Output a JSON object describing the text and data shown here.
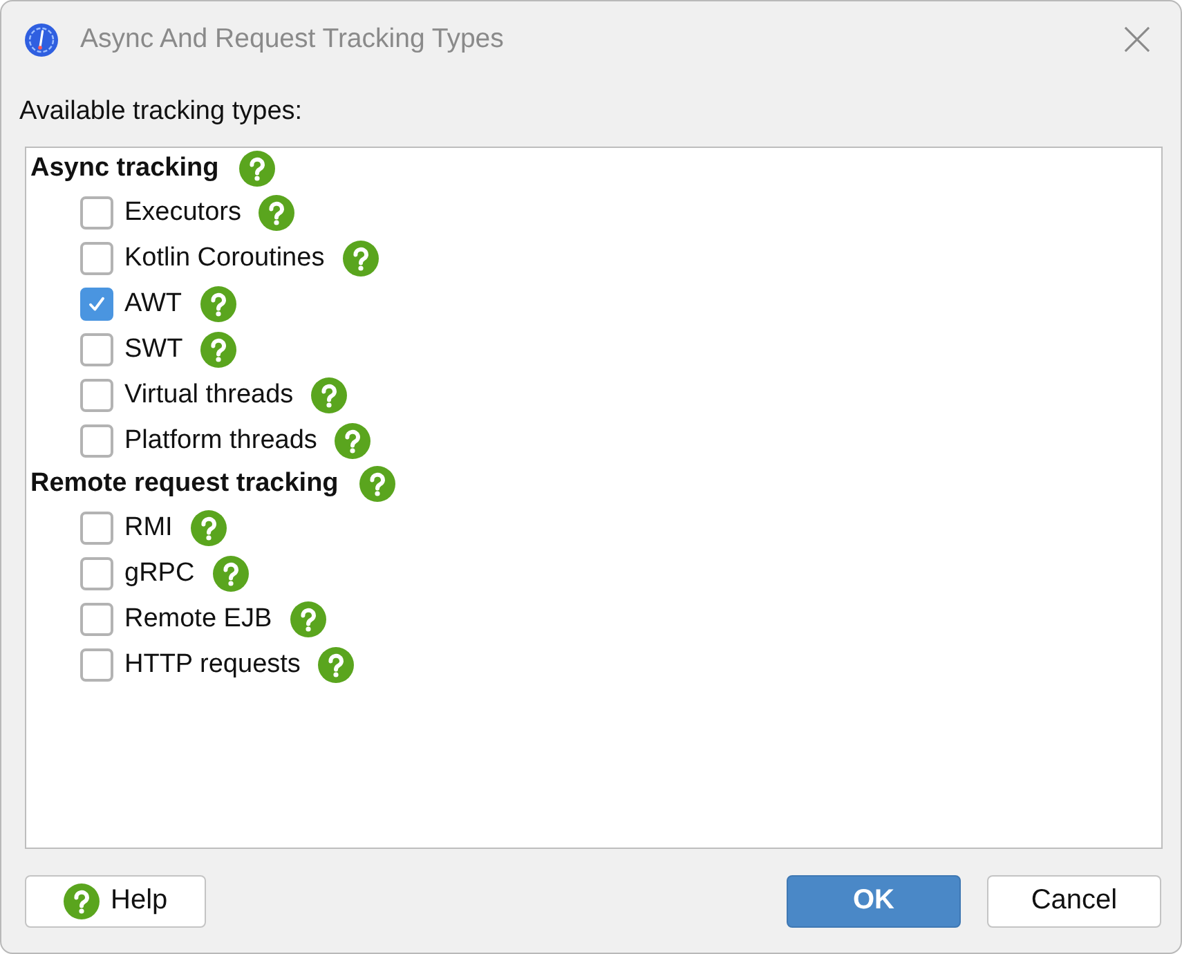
{
  "window": {
    "title": "Async And Request Tracking Types"
  },
  "list_label": "Available tracking types:",
  "tracking_types": [
    {
      "label": "Async tracking",
      "children": [
        {
          "label": "Executors",
          "checked": false
        },
        {
          "label": "Kotlin Coroutines",
          "checked": false
        },
        {
          "label": "AWT",
          "checked": true
        },
        {
          "label": "SWT",
          "checked": false
        },
        {
          "label": "Virtual threads",
          "checked": false
        },
        {
          "label": "Platform threads",
          "checked": false
        }
      ]
    },
    {
      "label": "Remote request tracking",
      "children": [
        {
          "label": "RMI",
          "checked": false
        },
        {
          "label": "gRPC",
          "checked": false
        },
        {
          "label": "Remote EJB",
          "checked": false
        },
        {
          "label": "HTTP requests",
          "checked": false
        }
      ]
    }
  ],
  "buttons": [
    {
      "label": "Help",
      "kind": "help"
    },
    {
      "label": "OK",
      "kind": "primary"
    },
    {
      "label": "Cancel",
      "kind": "secondary"
    }
  ]
}
